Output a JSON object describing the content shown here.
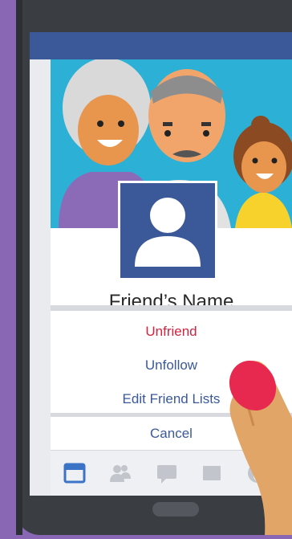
{
  "profile": {
    "name": "Friend’s Name"
  },
  "menu": {
    "unfriend_label": "Unfriend",
    "unfollow_label": "Unfollow",
    "edit_lists_label": "Edit Friend Lists",
    "cancel_label": "Cancel"
  },
  "bottom_nav": {
    "items": [
      "news-feed",
      "friends",
      "messages",
      "notifications",
      "more"
    ],
    "active": "news-feed"
  },
  "colors": {
    "background": "#8a67b4",
    "brand": "#3b5998",
    "danger": "#d0243e",
    "cover": "#2cb0d6"
  }
}
